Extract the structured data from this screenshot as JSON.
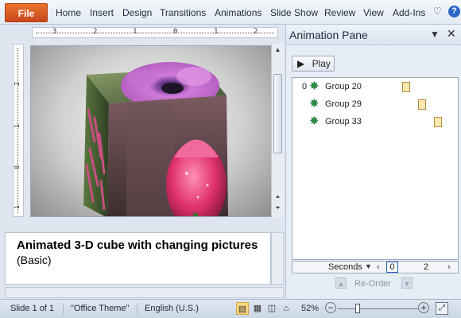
{
  "ribbon": {
    "file_label": "File",
    "tabs": [
      "Home",
      "Insert",
      "Design",
      "Transitions",
      "Animations",
      "Slide Show",
      "Review",
      "View",
      "Add-Ins"
    ],
    "help_icon": "help-icon",
    "minimize_icon": "ribbon-toggle-icon",
    "help_glyph": "?",
    "minimize_glyph": "♡"
  },
  "ruler": {
    "horizontal_ticks": [
      "3",
      "2",
      "1",
      "0",
      "1",
      "2"
    ],
    "vertical_ticks": [
      "2",
      "1",
      "0",
      "1"
    ]
  },
  "slide": {
    "image": "3D cube with flower pictures (pink flower, tulips)"
  },
  "notes": {
    "title": "Animated 3-D cube with changing pictures",
    "subtitle": "(Basic)"
  },
  "animation_pane": {
    "title": "Animation Pane",
    "play_label": "Play",
    "items": [
      {
        "number": "0",
        "name": "Group 20"
      },
      {
        "number": "",
        "name": "Group 29"
      },
      {
        "number": "",
        "name": "Group 33"
      }
    ],
    "timeline": {
      "unit_label": "Seconds",
      "start": "0",
      "end": "2"
    },
    "reorder_label": "Re-Order"
  },
  "status_bar": {
    "slide_info": "Slide 1 of 1",
    "theme": "\"Office Theme\"",
    "language": "English (U.S.)",
    "zoom": "52%"
  },
  "colors": {
    "file_tab": "#d4582a",
    "accent": "#2d66c3",
    "motion_star": "#2e8b45",
    "timing_bar": "#fde8b0"
  }
}
